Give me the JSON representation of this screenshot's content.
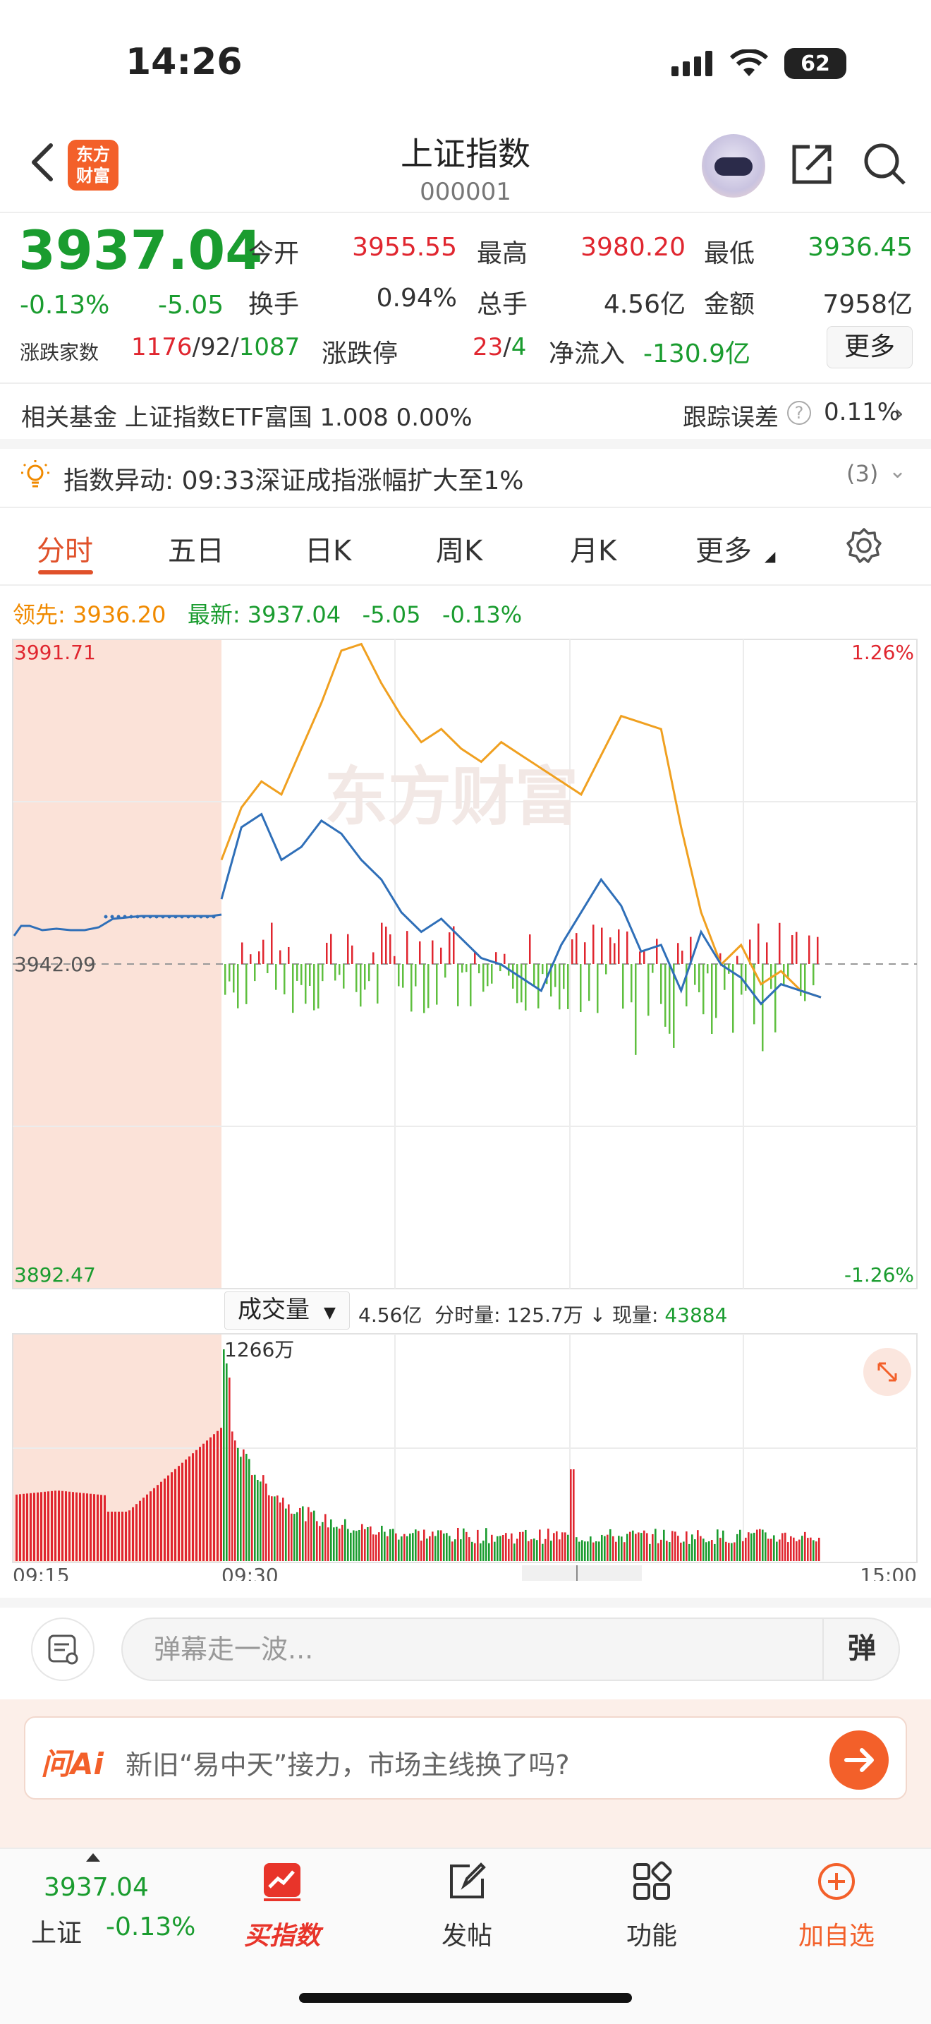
{
  "status_bar": {
    "time": "14:26",
    "battery": "62"
  },
  "nav": {
    "title": "上证指数",
    "code": "000001",
    "logo_line1": "东方",
    "logo_line2": "财富"
  },
  "quote": {
    "price": "3937.04",
    "change_pct": "-0.13%",
    "change_val": "-5.05",
    "fields": [
      {
        "label": "今开",
        "value": "3955.55"
      },
      {
        "label": "最高",
        "value": "3980.20"
      },
      {
        "label": "最低",
        "value": "3936.45"
      },
      {
        "label": "换手",
        "value": "0.94%"
      },
      {
        "label": "总手",
        "value": "4.56亿"
      },
      {
        "label": "金额",
        "value": "7958亿"
      }
    ],
    "breadth_label": "涨跌家数",
    "breadth_up": "1176",
    "breadth_flat": "92",
    "breadth_down": "1087",
    "limit_label": "涨跌停",
    "limit_up": "23",
    "limit_down": "4",
    "netflow_label": "净流入",
    "netflow_value": "-130.9亿",
    "more_label": "更多"
  },
  "fund": {
    "text": "相关基金  上证指数ETF富国 1.008 0.00%",
    "track_label": "跟踪误差",
    "track_value": "0.11%"
  },
  "alert": {
    "text": "指数异动: 09:33深证成指涨幅扩大至1%",
    "count": "(3)"
  },
  "tabs": [
    "分时",
    "五日",
    "日K",
    "周K",
    "月K",
    "更多"
  ],
  "legend": {
    "lead_label": "领先:",
    "lead_value": "3936.20",
    "latest_label": "最新:",
    "latest_value": "3937.04",
    "change": "-5.05",
    "pct": "-0.13%"
  },
  "chart_data": {
    "type": "line",
    "title": "",
    "y_max": "3991.71",
    "y_mid": "3942.09",
    "y_min": "3892.47",
    "pct_max": "1.26%",
    "pct_min": "-1.26%",
    "x_labels": [
      "09:15",
      "09:30",
      "15:00"
    ],
    "volume_peak_label": "1266万",
    "ylim": [
      3892.47,
      3991.71
    ],
    "series": [
      {
        "values": [
          3958,
          3966,
          3970,
          3968,
          3975,
          3982,
          3990,
          3991,
          3985,
          3980,
          3976,
          3978,
          3975,
          3973,
          3976,
          3974,
          3972,
          3970,
          3968,
          3974,
          3980,
          3979,
          3978,
          3963,
          3950,
          3942,
          3945,
          3939,
          3941,
          3938,
          3937
        ]
      },
      {
        "values": [
          3952,
          3963,
          3965,
          3958,
          3960,
          3964,
          3962,
          3958,
          3955,
          3950,
          3947,
          3949,
          3946,
          3943,
          3942,
          3940,
          3938,
          3945,
          3950,
          3955,
          3951,
          3944,
          3945,
          3938,
          3947,
          3942,
          3940,
          3936,
          3939,
          3938,
          3937
        ]
      }
    ]
  },
  "volume": {
    "select_label": "成交量",
    "info_total": "4.56亿",
    "info_min_label": "分时量:",
    "info_min_value": "125.7万",
    "info_now_label": "现量:",
    "info_now_value": "43884"
  },
  "danmaku": {
    "placeholder": "弹幕走一波...",
    "send_label": "弹"
  },
  "ai": {
    "logo": "问Ai",
    "text": "新旧“易中天”接力，市场主线换了吗?"
  },
  "bottom": {
    "price": "3937.04",
    "name": "上证",
    "pct": "-0.13%",
    "items": [
      "买指数",
      "发帖",
      "功能",
      "加自选"
    ]
  },
  "colors": {
    "up": "#e0262f",
    "down": "#1a9c2f",
    "accent": "#f3602a",
    "line_lead": "#f0a020",
    "line_latest": "#2f6fb8"
  }
}
